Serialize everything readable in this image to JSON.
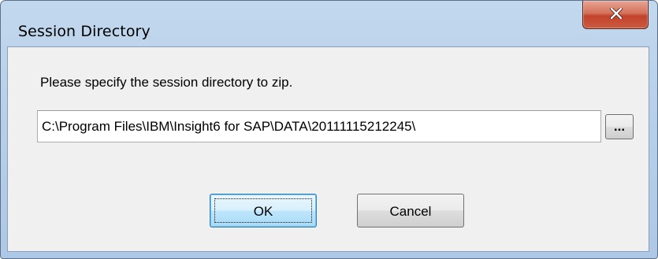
{
  "window": {
    "title": "Session Directory",
    "close_glyph": "close-icon"
  },
  "dialog": {
    "prompt": "Please specify the session directory to zip.",
    "path_value": "C:\\Program Files\\IBM\\Insight6 for SAP\\DATA\\20111115212245\\",
    "browse_label": "...",
    "ok_label": "OK",
    "cancel_label": "Cancel"
  },
  "colors": {
    "frame": "#b9d1ea",
    "close_button": "#c2432b",
    "client_background": "#f0f0f0",
    "default_button_border": "#3c7fb1"
  }
}
